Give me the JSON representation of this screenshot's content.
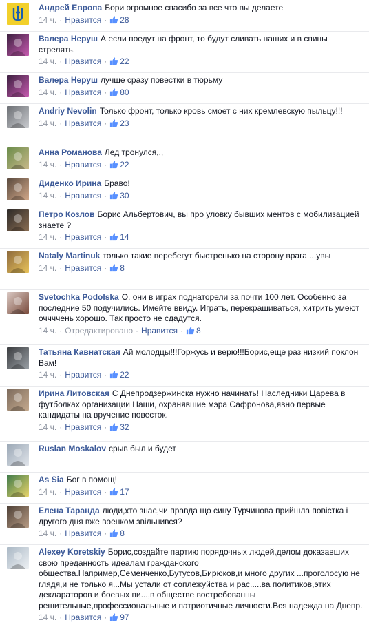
{
  "like_label": "Нравится",
  "comments": [
    {
      "author": "Андрей Европа",
      "text": "Бори огромное спасибо за все что вы делаете",
      "time": "14 ч.",
      "likes": "28",
      "avatar": "trident"
    },
    {
      "author": "Валера Неруш",
      "text": "А если поедут на фронт, то будут сливать наших и в спины стрелять.",
      "time": "14 ч.",
      "likes": "22",
      "avatar": "purple"
    },
    {
      "author": "Валера Неруш",
      "text": "лучше сразу повестки в тюрьму",
      "time": "14 ч.",
      "likes": "80",
      "avatar": "purple"
    },
    {
      "author": "Andriy Nevolin",
      "text": "Только фронт, только кровь смоет с них кремлевскую пыльцу!!!",
      "time": "14 ч.",
      "likes": "23",
      "avatar": "gray"
    },
    {
      "author": "Анна Романова",
      "text": "Лед тронулся,,,",
      "time": "14 ч.",
      "likes": "22",
      "avatar": "green"
    },
    {
      "author": "Диденко Ирина",
      "text": "Браво!",
      "time": "14 ч.",
      "likes": "30",
      "avatar": "face"
    },
    {
      "author": "Петро Козлов",
      "text": "Борис Альбертович, вы про уловку бывших ментов с мобилизацией знаете ?",
      "time": "14 ч.",
      "likes": "14",
      "avatar": "dark"
    },
    {
      "author": "Nataly Martinuk",
      "text": "только такие перебегут быстренько на сторону врага ...увы",
      "time": "14 ч.",
      "likes": "8",
      "avatar": "flowers"
    },
    {
      "author": "Svetochka Podolska",
      "text": "О, они в играх поднаторели за почти 100 лет. Особенно за последние 50 подучились. Имейте ввиду. Играть, перекрашиваться, хитрить умеют оччччень хорошо. Так просто не сдадутся.",
      "time": "14 ч.",
      "edited": "Отредактировано",
      "likes": "8",
      "avatar": "glasses"
    },
    {
      "author": "Татьяна Кавнатская",
      "text": "Ай молодцы!!!Горжусь и верю!!!Борис,еще раз низкий поклон Вам!",
      "time": "14 ч.",
      "likes": "22",
      "avatar": "darkgray"
    },
    {
      "author": "Ирина Литовская",
      "text": "С Днепродзержинска нужно начинать! Наследники Царева в футболках организации Наши, охранявшие мэра Сафронова,явно первые кандидаты на вручение повесток.",
      "time": "14 ч.",
      "likes": "32",
      "avatar": "group"
    },
    {
      "author": "Ruslan Moskalov",
      "text": "срыв был и будет",
      "time": "",
      "likes": "",
      "avatar": "car"
    },
    {
      "author": "As Sia",
      "text": "Бог в помощ!",
      "time": "14 ч.",
      "likes": "17",
      "avatar": "bright"
    },
    {
      "author": "Елена Таранда",
      "text": "люди,хто знає,чи правда що сину Турчинова прийшла повістка і другого дня вже военком звільнився?",
      "time": "14 ч.",
      "likes": "8",
      "avatar": "brown"
    },
    {
      "author": "Alexey Koretskiy",
      "text": "Борис,создайте партию порядочных людей,делом доказавших свою преданность идеалам гражданского общества.Например,Семенченко,Бутусов,Бирюков,и много других ...проголосую не глядя,и не только я...Мы устали от соплежуйства и рас.....ва политиков,этих деклараторов и боевых пи...,в обществе востребованны решительные,профессиональные и патриотичные личности.Вся надежда на Днепр.",
      "time": "14 ч.",
      "likes": "97",
      "avatar": "light"
    }
  ]
}
